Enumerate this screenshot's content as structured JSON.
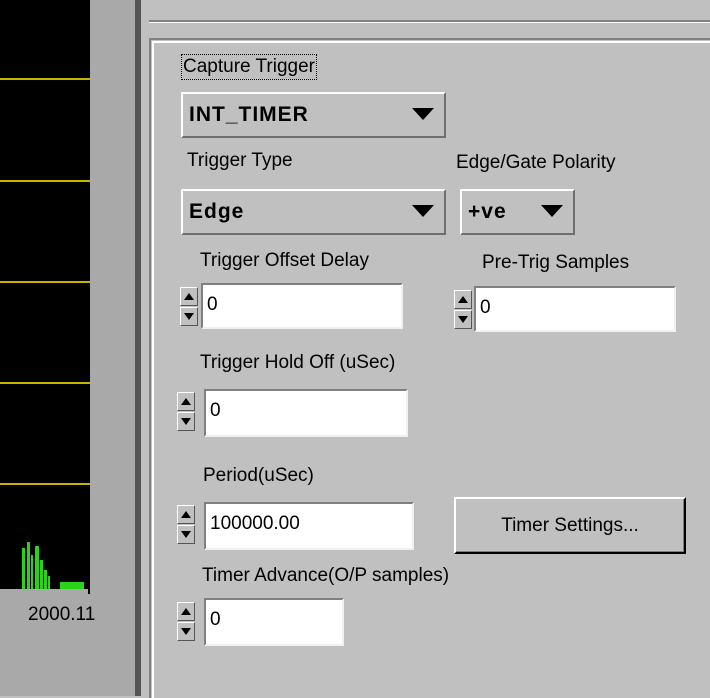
{
  "plot": {
    "x_axis_label": "2000.11",
    "background_color": "#000000",
    "grid_color": "#c8b400",
    "trace_color": "#2ad21a"
  },
  "trigger": {
    "capture_trigger_label": "Capture Trigger",
    "capture_trigger_value": "INT_TIMER",
    "trigger_type_label": "Trigger Type",
    "trigger_type_value": "Edge",
    "edge_polarity_label": "Edge/Gate Polarity",
    "edge_polarity_value": "+ve",
    "offset_delay_label": "Trigger Offset Delay",
    "offset_delay_value": "0",
    "pretrig_label": "Pre-Trig Samples",
    "pretrig_value": "0",
    "hold_off_label": "Trigger Hold Off (uSec)",
    "hold_off_value": "0",
    "period_label": "Period(uSec)",
    "period_value": "100000.00",
    "timer_settings_label": "Timer Settings...",
    "timer_advance_label": "Timer Advance(O/P samples)",
    "timer_advance_value": "0"
  }
}
